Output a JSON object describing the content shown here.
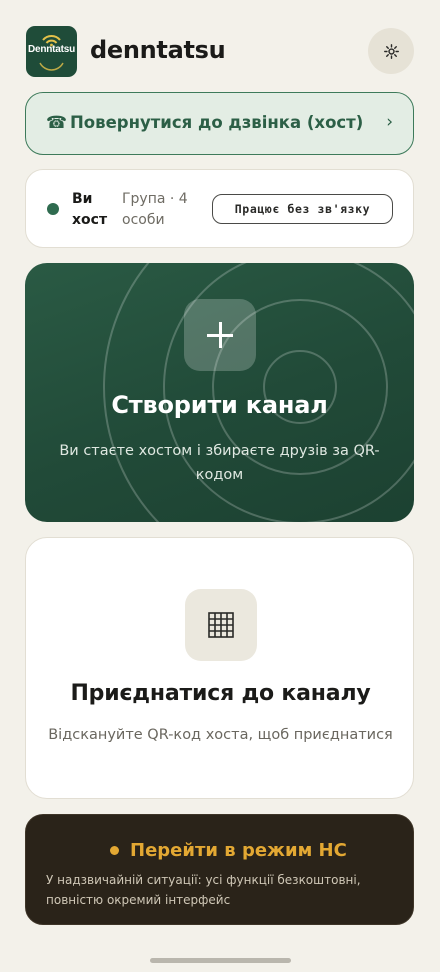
{
  "header": {
    "logo_text": "Denntatsu",
    "app_name": "denntatsu",
    "settings_icon": "gear-icon"
  },
  "return_call": {
    "icon": "phone-icon",
    "icon_glyph": "☎",
    "label": "Повернутися до дзвінка (хост)",
    "chevron": "›"
  },
  "status": {
    "role": "Ви хост",
    "group": "Група · 4 особи",
    "connectivity": "Працює без зв'язку",
    "dot_color": "#2f6b4f"
  },
  "create": {
    "icon": "plus-icon",
    "title": "Створити канал",
    "subtitle": "Ви стаєте хостом і збираєте друзів за QR-кодом"
  },
  "join": {
    "icon": "qr-grid-icon",
    "title": "Приєднатися до каналу",
    "subtitle": "Відскануйте QR-код хоста, щоб приєднатися"
  },
  "emergency": {
    "title": "Перейти в режим НС",
    "subtitle": "У надзвичайній ситуації: усі функції безкоштовні, повністю окремий інтерфейс",
    "accent": "#e3a833"
  },
  "colors": {
    "background": "#f3f1ea",
    "brand_green": "#1f4c39",
    "create_card": "#244e3b",
    "emergency_bg": "#2a2319"
  }
}
